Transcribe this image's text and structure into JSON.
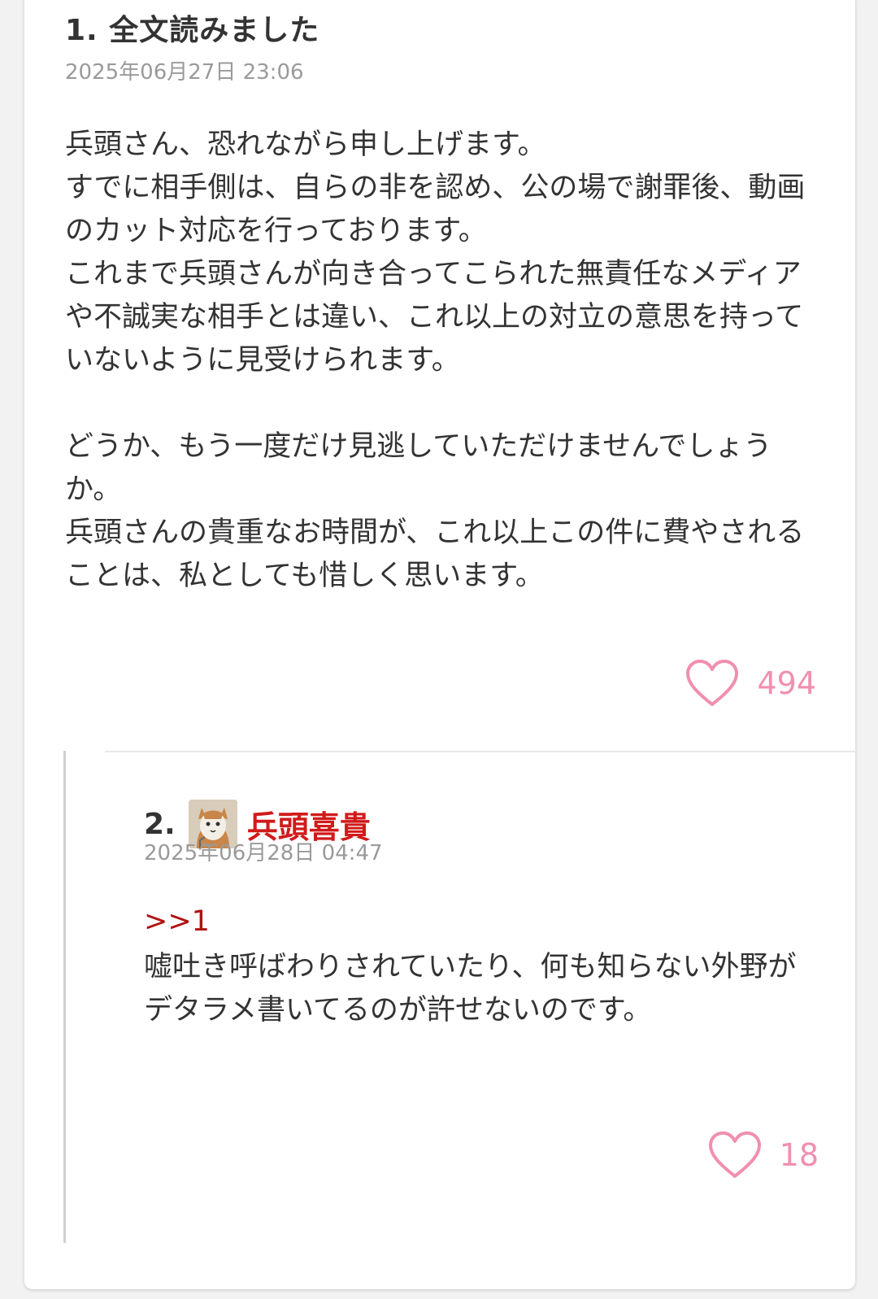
{
  "comments": [
    {
      "title": "1. 全文読みました",
      "date": "2025年06月27日 23:06",
      "body_lines": [
        "兵頭さん、恐れながら申し上げます。\nすでに相手側は、自らの非を認め、公の場で謝罪後、動画のカット対応を行っております。\nこれまで兵頭さんが向き合ってこられた無責任なメディアや不誠実な相手とは違い、これ以上の対立の意思を持っていないように見受けられます。",
        "どうか、もう一度だけ見逃していただけませんでしょうか。\n兵頭さんの貴重なお時間が、これ以上この件に費やされることは、私としても惜しく思います。"
      ],
      "likes": "494"
    }
  ],
  "reply": {
    "number": "2.",
    "author": "兵頭喜貴",
    "date": "2025年06月28日 04:47",
    "anchor": ">>1",
    "body": "嘘吐き呼ばわりされていたり、何も知らない外野がデタラメ書いてるのが許せないのです。",
    "likes": "18"
  },
  "icons": {
    "like": "heart-outline-icon",
    "avatar": "cat-avatar-icon"
  },
  "colors": {
    "like_pink": "#f08fb0",
    "author_red": "#d11a1a",
    "anchor_red": "#b01212",
    "date_gray": "#9a9a9a"
  }
}
